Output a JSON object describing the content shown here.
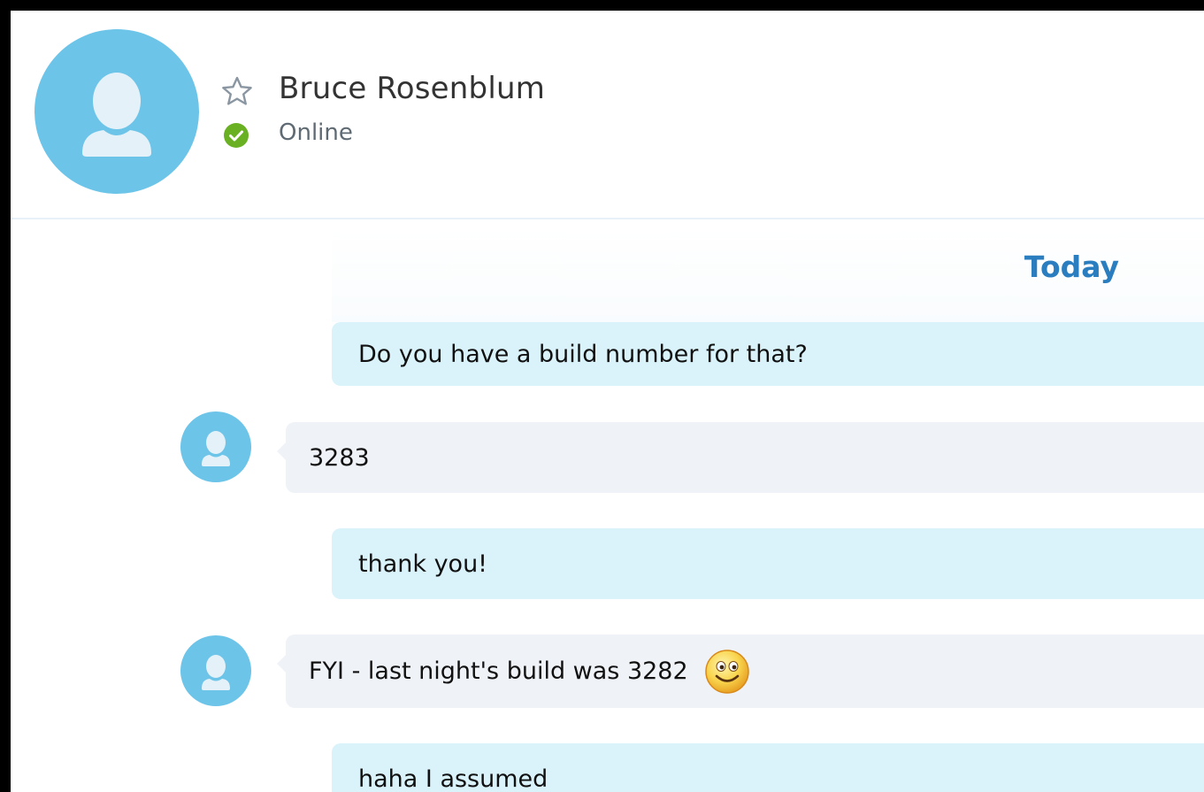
{
  "contact": {
    "name": "Bruce Rosenblum",
    "status": "Online"
  },
  "chat": {
    "date_separator": "Today",
    "messages": [
      {
        "direction": "outgoing",
        "text": "Do you have a build number for that?"
      },
      {
        "direction": "incoming",
        "text": "3283"
      },
      {
        "direction": "outgoing",
        "text": "thank you!"
      },
      {
        "direction": "incoming",
        "text": "FYI - last night's build was 3282",
        "emoji": "smile-emoji"
      },
      {
        "direction": "outgoing",
        "text": "haha I assumed"
      }
    ]
  },
  "icons": {
    "favorite": "star-outline-icon",
    "presence": "online-check-icon",
    "avatar": "person-silhouette-icon"
  },
  "colors": {
    "avatar_bg": "#6cc4e9",
    "outgoing_bubble": "#daf3fb",
    "incoming_bubble": "#eff3f7",
    "online_green": "#6ab023",
    "date_blue": "#2a7dbf"
  }
}
